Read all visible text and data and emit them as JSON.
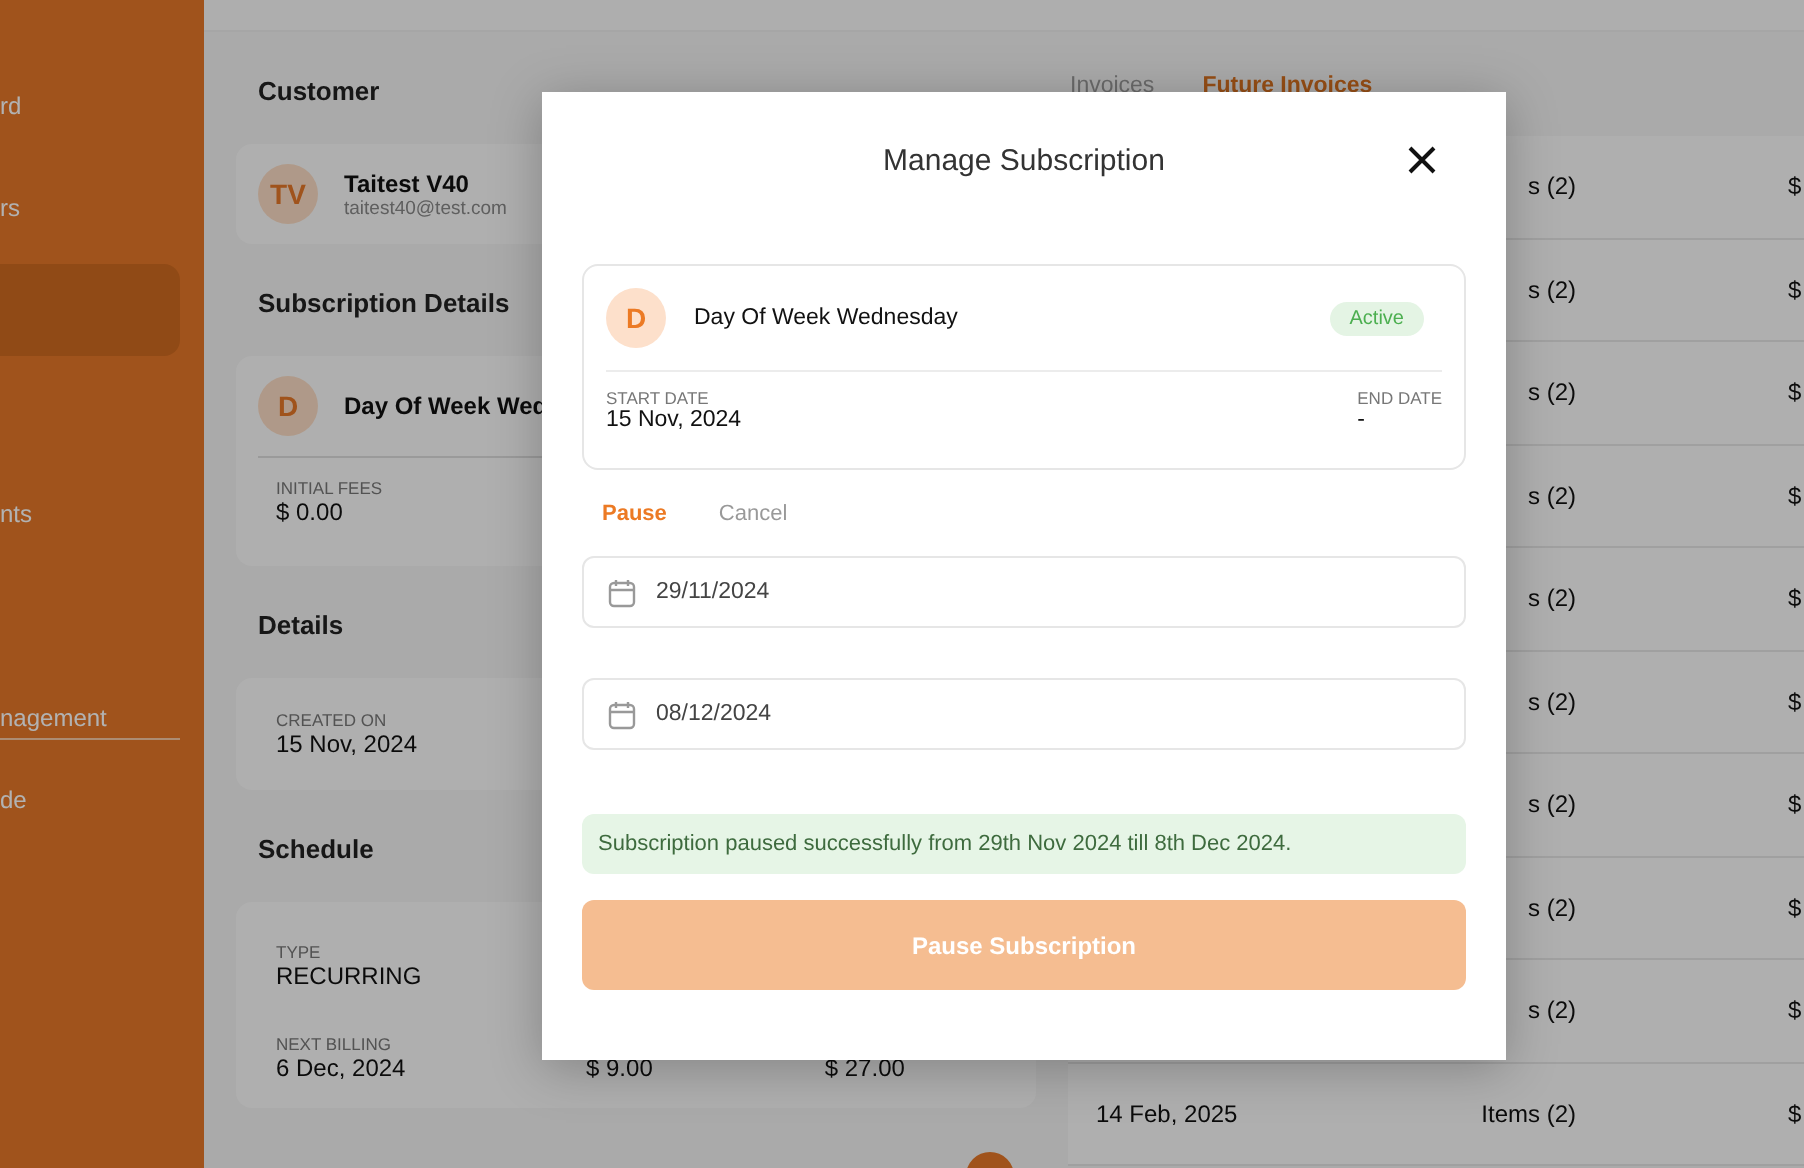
{
  "sidebar": {
    "items": [
      {
        "label": "rd",
        "selected": false
      },
      {
        "label": "rs",
        "selected": false
      },
      {
        "selected": true
      },
      {
        "label": "nts",
        "selected": false
      },
      {
        "label": "nagement",
        "selected": false
      }
    ],
    "footer_items": [
      {
        "label": "de"
      }
    ]
  },
  "customer": {
    "heading": "Customer",
    "initials": "TV",
    "name": "Taitest V40",
    "email": "taitest40@test.com"
  },
  "subscription_details": {
    "heading": "Subscription Details",
    "initial": "D",
    "name": "Day Of Week Wed",
    "fees_label": "INITIAL FEES",
    "fees_value": "$ 0.00"
  },
  "details": {
    "heading": "Details",
    "created_label": "CREATED ON",
    "created_value": "15 Nov, 2024"
  },
  "schedule": {
    "heading": "Schedule",
    "type_label": "TYPE",
    "type_value": "RECURRING",
    "next_label": "NEXT BILLING",
    "next_value": "6 Dec, 2024",
    "column_2": "$ 9.00",
    "column_3": "$ 27.00"
  },
  "invoice_tabs": [
    {
      "label": "Invoices",
      "selected": false
    },
    {
      "label": "Future Invoices",
      "selected": true
    }
  ],
  "invoice_rows": [
    {
      "items": "s (2)",
      "amount": "$"
    },
    {
      "items": "s (2)",
      "amount": "$"
    },
    {
      "items": "s (2)",
      "amount": "$"
    },
    {
      "items": "s (2)",
      "amount": "$"
    },
    {
      "items": "s (2)",
      "amount": "$"
    },
    {
      "items": "s (2)",
      "amount": "$"
    },
    {
      "items": "s (2)",
      "amount": "$"
    },
    {
      "items": "s (2)",
      "amount": "$"
    },
    {
      "items": "s (2)",
      "amount": "$"
    },
    {
      "date": "14 Feb, 2025",
      "items": "Items (2)",
      "amount": "$"
    }
  ],
  "modal": {
    "title": "Manage Subscription",
    "subscription": {
      "initial": "D",
      "name": "Day Of Week Wednesday",
      "status": "Active",
      "start_label": "START DATE",
      "start_value": "15 Nov, 2024",
      "end_label": "END DATE",
      "end_value": "-"
    },
    "tabs": [
      {
        "label": "Pause",
        "selected": true
      },
      {
        "label": "Cancel",
        "selected": false
      }
    ],
    "date_fields": [
      {
        "value": "29/11/2024"
      },
      {
        "value": "08/12/2024"
      }
    ],
    "alert": "Subscription paused successfully from 29th Nov 2024 till 8th Dec 2024.",
    "button": {
      "label": "Pause Subscription",
      "disabled": true
    }
  }
}
